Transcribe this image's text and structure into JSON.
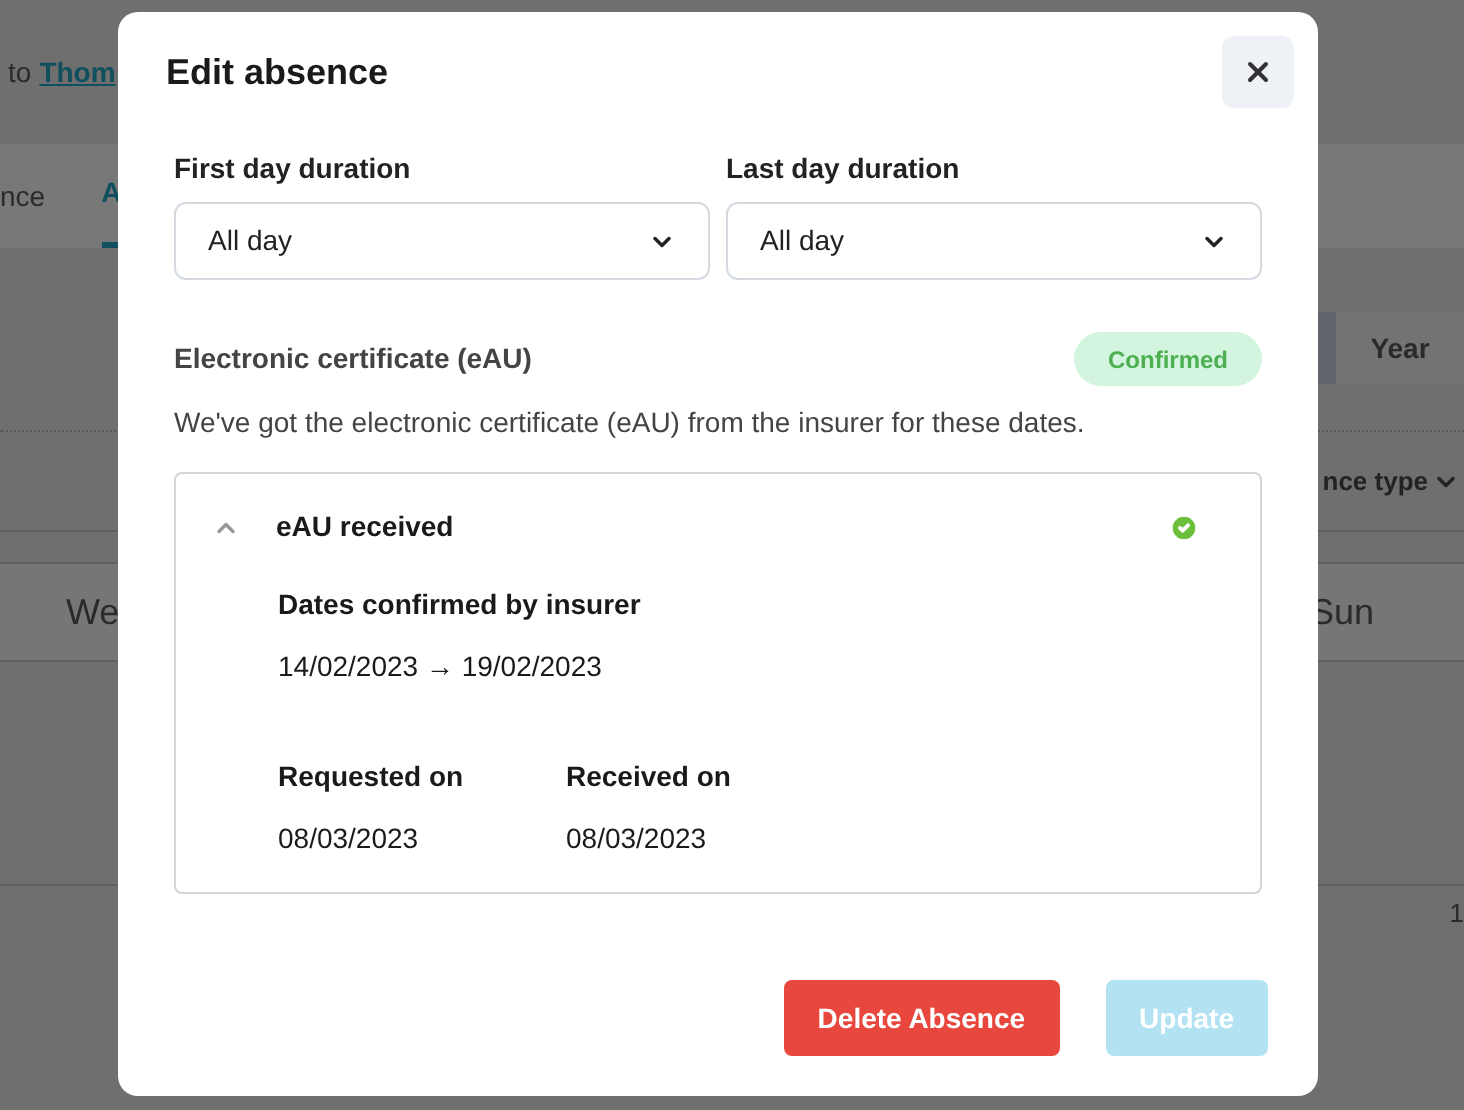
{
  "background": {
    "breadcrumb": {
      "prefix": "to",
      "link": "Thom"
    },
    "tabs": [
      {
        "label": "nce",
        "selected": false
      },
      {
        "label": "A",
        "selected": true
      }
    ],
    "period_options": [
      {
        "selected": true
      },
      {
        "label": "Year",
        "selected": false
      }
    ],
    "filter": {
      "label": "nce type"
    },
    "week_header": {
      "first_day": "We",
      "last_day": "Sun"
    },
    "day_number": "1"
  },
  "modal": {
    "title": "Edit absence",
    "fields": [
      {
        "label": "First day duration",
        "value": "All day"
      },
      {
        "label": "Last day duration",
        "value": "All day"
      }
    ],
    "certificate": {
      "title": "Electronic certificate (eAU)",
      "status": "Confirmed",
      "description": "We've got the electronic certificate (eAU) from the insurer for these dates.",
      "panel": {
        "title": "eAU received",
        "expanded": true,
        "received": true,
        "dates_label": "Dates confirmed by insurer",
        "dates": "14/02/2023 → 19/02/2023",
        "details": [
          {
            "label": "Requested on",
            "value": "08/03/2023"
          },
          {
            "label": "Received on",
            "value": "08/03/2023"
          }
        ]
      }
    }
  },
  "buttons": [
    {
      "kind": "danger",
      "label": "Delete Absence",
      "disabled": false
    },
    {
      "kind": "primary",
      "label": "Update",
      "disabled": true
    }
  ]
}
